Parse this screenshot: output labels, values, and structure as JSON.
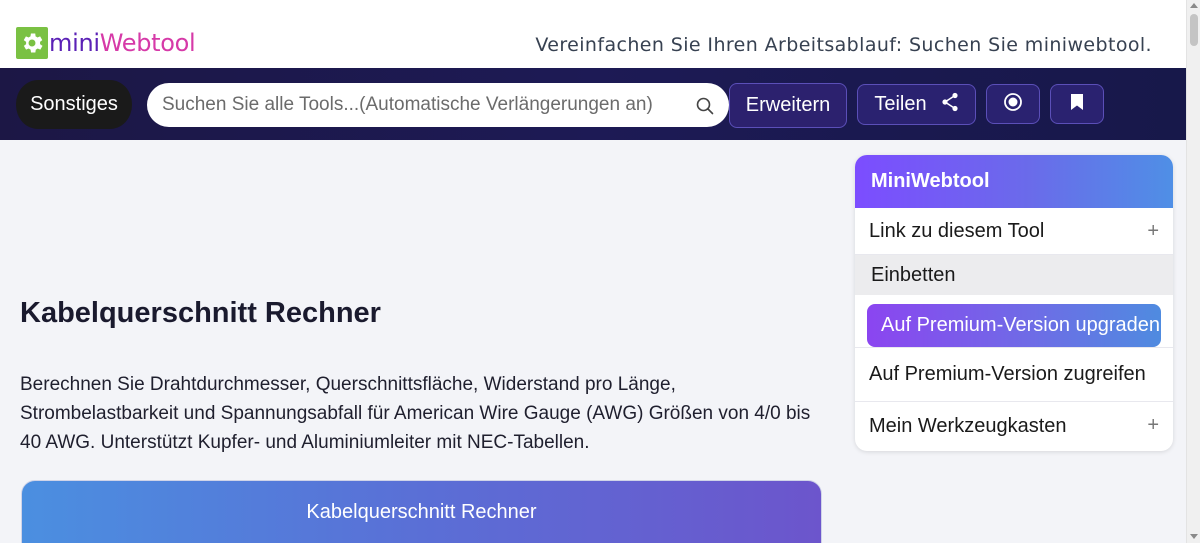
{
  "header": {
    "logo_icon": "gear-icon",
    "logo_mini": "mini",
    "logo_web": "Webtool",
    "tagline": "Vereinfachen Sie Ihren Arbeitsablauf: Suchen Sie miniwebtool."
  },
  "nav": {
    "category_label": "Sonstiges",
    "search_placeholder": "Suchen Sie alle Tools...(Automatische Verlängerungen an)",
    "search_icon": "search-icon",
    "expand_label": "Erweitern",
    "share_label": "Teilen",
    "share_icon": "share-icon",
    "record_icon": "record-icon",
    "bookmark_icon": "bookmark-icon"
  },
  "main": {
    "title": "Kabelquerschnitt Rechner",
    "description": "Berechnen Sie Drahtdurchmesser, Querschnittsfläche, Widerstand pro Länge, Strombelastbarkeit und Spannungsabfall für American Wire Gauge (AWG) Größen von 4/0 bis 40 AWG. Unterstützt Kupfer- und Aluminiumleiter mit NEC-Tabellen.",
    "card_title": "Kabelquerschnitt Rechner"
  },
  "sidebar": {
    "title": "MiniWebtool",
    "link_label": "Link zu diesem Tool",
    "embed_label": "Einbetten",
    "upgrade_label": "Auf Premium-Version upgraden",
    "access_label": "Auf Premium-Version zugreifen",
    "toolbox_label": "Mein Werkzeugkasten",
    "plus_symbol": "+"
  },
  "colors": {
    "nav_bg": "#1c1745",
    "accent_purple": "#7c4dff",
    "accent_blue": "#4f8fe6",
    "logo_green": "#7ac143",
    "logo_mini": "#5b21b6",
    "logo_web": "#d63aa8"
  }
}
